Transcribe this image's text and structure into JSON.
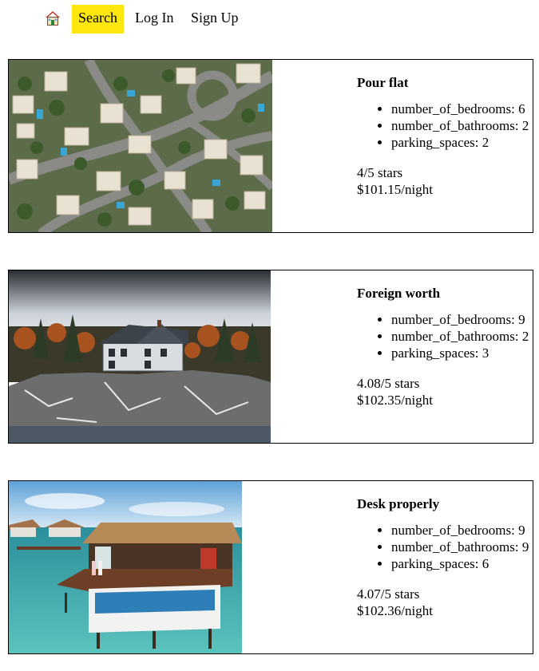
{
  "nav": {
    "home_icon": "house-icon",
    "search_label": "Search",
    "login_label": "Log In",
    "signup_label": "Sign Up",
    "active_color": "#fde70e"
  },
  "listings": [
    {
      "title": "Pour flat",
      "image": "aerial-suburb-photo",
      "features": [
        "number_of_bedrooms: 6",
        "number_of_bathrooms: 2",
        "parking_spaces: 2"
      ],
      "rating": "4/5 stars",
      "price": "$101.15/night"
    },
    {
      "title": "Foreign worth",
      "image": "lakeside-house-photo",
      "features": [
        "number_of_bedrooms: 9",
        "number_of_bathrooms: 2",
        "parking_spaces: 3"
      ],
      "rating": "4.08/5 stars",
      "price": "$102.35/night"
    },
    {
      "title": "Desk properly",
      "image": "overwater-villa-photo",
      "features": [
        "number_of_bedrooms: 9",
        "number_of_bathrooms: 9",
        "parking_spaces: 6"
      ],
      "rating": "4.07/5 stars",
      "price": "$102.36/night"
    }
  ]
}
